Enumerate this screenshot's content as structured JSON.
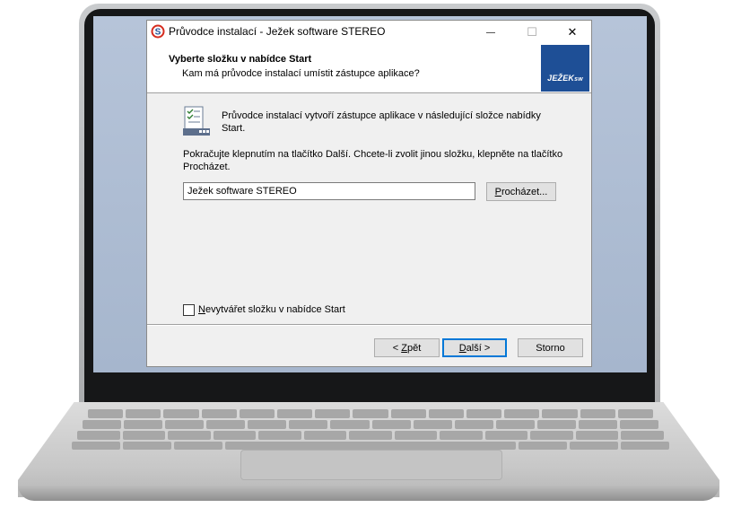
{
  "window": {
    "title": "Průvodce instalací - Ježek software STEREO",
    "controls": {
      "minimize": "—",
      "maximize": "☐",
      "close": "✕"
    }
  },
  "header": {
    "title": "Vyberte složku v nabídce Start",
    "subtitle": "Kam má průvodce instalací umístit zástupce aplikace?",
    "logo_text": "JEŽEK",
    "logo_suffix": "sw"
  },
  "content": {
    "info_line1": "Průvodce instalací vytvoří zástupce aplikace v následující složce nabídky",
    "info_line2": "Start.",
    "instruction_line1": "Pokračujte klepnutím na tlačítko Další. Chcete-li zvolit jinou složku, klepněte na tlačítko",
    "instruction_line2": "Procházet.",
    "folder_value": "Ježek software STEREO",
    "browse_button": {
      "underlined": "P",
      "rest": "rocházet..."
    },
    "checkbox": {
      "underlined": "N",
      "rest": "evytvářet složku v nabídce Start",
      "checked": false
    }
  },
  "footer": {
    "back_button": {
      "before": "< ",
      "underlined": "Z",
      "rest": "pět"
    },
    "next_button": {
      "underlined": "D",
      "rest": "alší >"
    },
    "cancel_button": "Storno"
  },
  "colors": {
    "accent": "#0078d7",
    "logo_bg": "#1e4f96",
    "desktop": "#b6c4d9"
  },
  "icons": {
    "app": "stereo-s-icon",
    "folder": "start-menu-folder-icon"
  }
}
